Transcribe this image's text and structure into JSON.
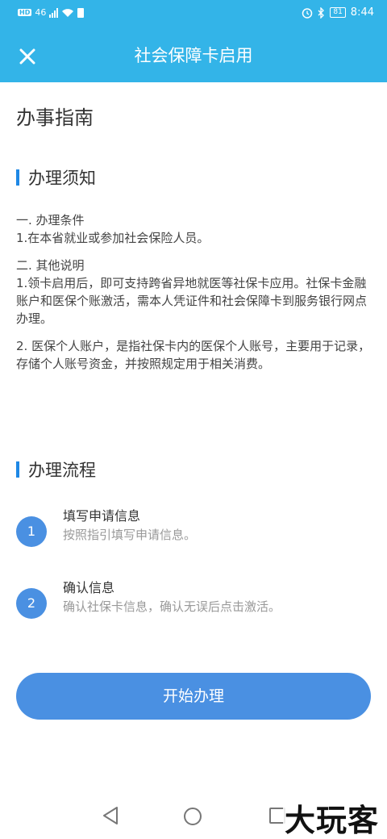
{
  "status": {
    "left_badge": "HD",
    "network": "46",
    "time": "8:44",
    "battery": "81"
  },
  "header": {
    "title": "社会保障卡启用"
  },
  "page": {
    "title": "办事指南"
  },
  "notice": {
    "heading": "办理须知",
    "cond_title": "一. 办理条件",
    "cond_text": "1.在本省就业或参加社会保险人员。",
    "other_title": "二. 其他说明",
    "other_text1": "1.领卡启用后，即可支持跨省异地就医等社保卡应用。社保卡金融账户和医保个账激活，需本人凭证件和社会保障卡到服务银行网点办理。",
    "other_text2": "2. 医保个人账户，是指社保卡内的医保个人账号，主要用于记录，存储个人账号资金，并按照规定用于相关消费。"
  },
  "process": {
    "heading": "办理流程",
    "steps": [
      {
        "num": "1",
        "title": "填写申请信息",
        "desc": "按照指引填写申请信息。"
      },
      {
        "num": "2",
        "title": "确认信息",
        "desc": "确认社保卡信息，确认无误后点击激活。"
      }
    ]
  },
  "actions": {
    "start_label": "开始办理"
  },
  "watermark": {
    "text": "大玩客"
  },
  "colors": {
    "header_bg": "#33b4e8",
    "accent": "#4a90e2",
    "section_bar": "#1e88e5"
  }
}
